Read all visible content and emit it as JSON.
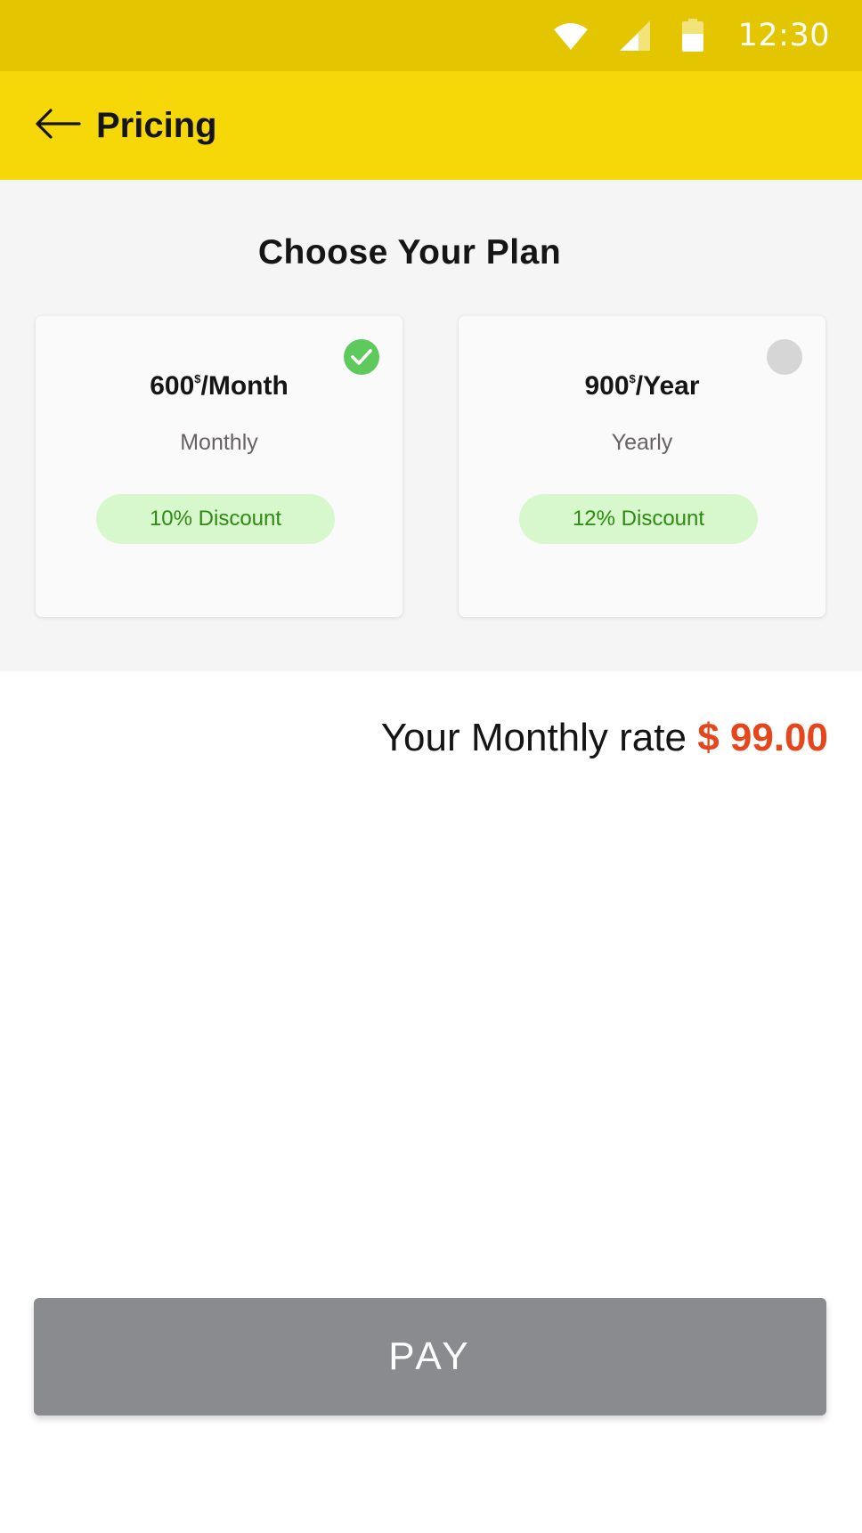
{
  "status_bar": {
    "time": "12:30",
    "icons": [
      "wifi-icon",
      "cell-signal-icon",
      "battery-icon"
    ]
  },
  "app_bar": {
    "title": "Pricing",
    "back_icon": "arrow-left-icon"
  },
  "plans": {
    "title": "Choose Your Plan",
    "items": [
      {
        "amount": "600",
        "currency": "$",
        "period": "/Month",
        "name": "Monthly",
        "discount": "10% Discount",
        "selected": true
      },
      {
        "amount": "900",
        "currency": "$",
        "period": "/Year",
        "name": "Yearly",
        "discount": "12% Discount",
        "selected": false
      }
    ]
  },
  "rate": {
    "label": "Your Monthly rate",
    "value": "$ 99.00"
  },
  "pay_button": {
    "label": "PAY"
  },
  "colors": {
    "status_bar": "#e4c600",
    "app_bar": "#f6d809",
    "selected_check": "#5ec95c",
    "badge_bg": "#d7f8cc",
    "badge_text": "#2e8a12",
    "rate_value": "#e6461b",
    "pay_button": "#8a8b8e"
  }
}
